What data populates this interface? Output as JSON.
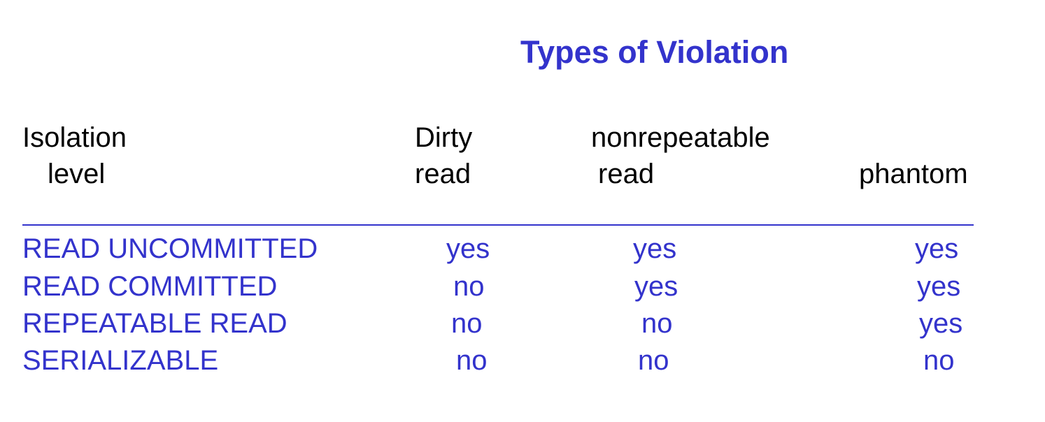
{
  "title": "Types of Violation",
  "headers": {
    "isolation_line1": "Isolation",
    "isolation_line2": "level",
    "dirty_line1": "Dirty",
    "dirty_line2": "read",
    "nonrep_line1": "nonrepeatable",
    "nonrep_line2": "read",
    "phantom": "phantom"
  },
  "rows": [
    {
      "level": "READ UNCOMMITTED",
      "dirty": "yes",
      "nonrepeatable": "yes",
      "phantom": "yes"
    },
    {
      "level": "READ COMMITTED",
      "dirty": "no",
      "nonrepeatable": "yes",
      "phantom": "yes"
    },
    {
      "level": "REPEATABLE READ",
      "dirty": "no",
      "nonrepeatable": "no",
      "phantom": "yes"
    },
    {
      "level": "SERIALIZABLE",
      "dirty": "no",
      "nonrepeatable": "no",
      "phantom": "no"
    }
  ],
  "colors": {
    "accent": "#3333cc",
    "header_text": "#000000",
    "background": "#ffffff"
  }
}
